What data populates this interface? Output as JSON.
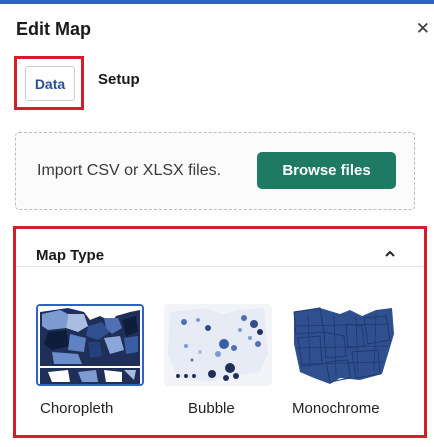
{
  "header": {
    "title": "Edit Map",
    "close_icon": "close-icon"
  },
  "tabs": [
    {
      "label": "Data",
      "active": true
    },
    {
      "label": "Setup",
      "active": false
    }
  ],
  "upload": {
    "instruction": "Import CSV or XLSX files.",
    "button_label": "Browse files"
  },
  "map_type": {
    "title": "Map Type",
    "toggle_icon": "chevron-up-icon",
    "options": [
      {
        "label": "Choropleth",
        "selected": true
      },
      {
        "label": "Bubble",
        "selected": false
      },
      {
        "label": "Monochrome",
        "selected": false
      }
    ]
  },
  "colors": {
    "accent": "#2f62c9",
    "button": "#1f7a63",
    "highlight": "#d21f2b"
  }
}
